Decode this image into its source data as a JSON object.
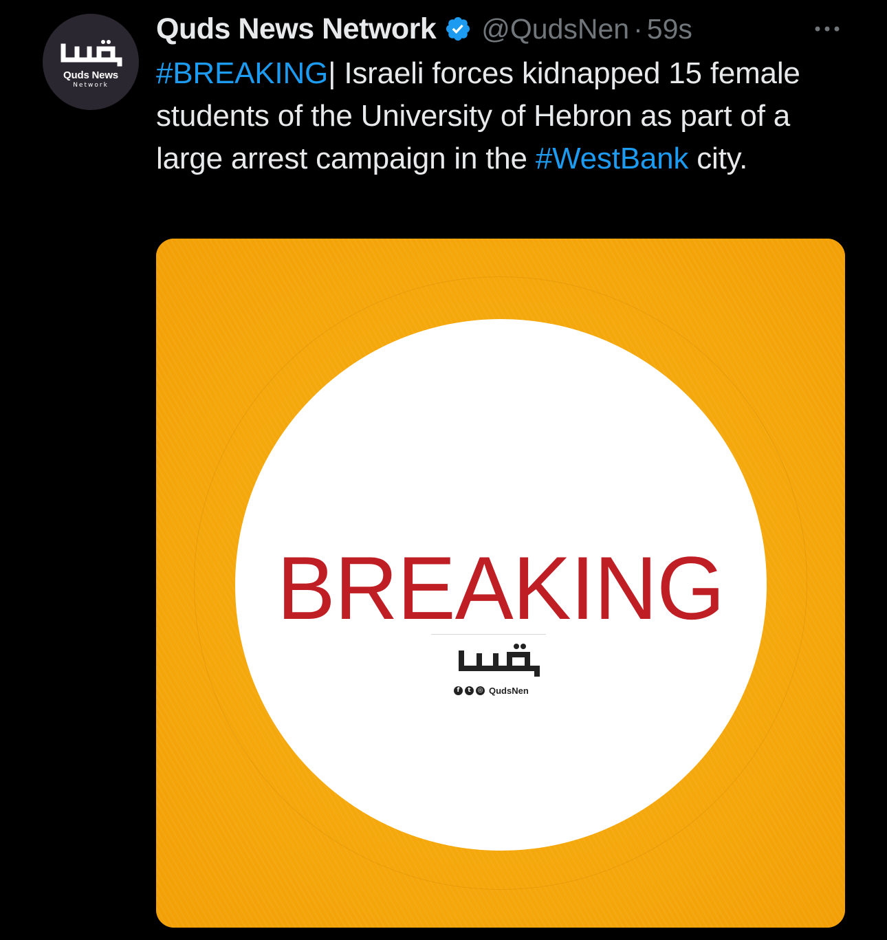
{
  "author": {
    "display_name": "Quds News Network",
    "handle": "@QudsNen",
    "separator": "·",
    "timestamp": "59s",
    "avatar_name": "Quds News",
    "avatar_sub": "Network",
    "verified": true
  },
  "tweet": {
    "hashtag1": "#BREAKING",
    "text_part1": "| Israeli forces kidnapped 15 female students of the University of Hebron as part of a large arrest campaign in the ",
    "hashtag2": "#WestBank",
    "text_part2": " city."
  },
  "media": {
    "headline": "BREAKING",
    "watermark_handle": "QudsNen",
    "social_icons": [
      "facebook-icon",
      "twitter-icon",
      "instagram-icon"
    ]
  },
  "colors": {
    "background": "#000000",
    "text": "#e7e9ea",
    "muted": "#71767b",
    "link": "#1d9bf0",
    "media_orange": "#f5a80c",
    "breaking_red": "#bf1e25"
  }
}
